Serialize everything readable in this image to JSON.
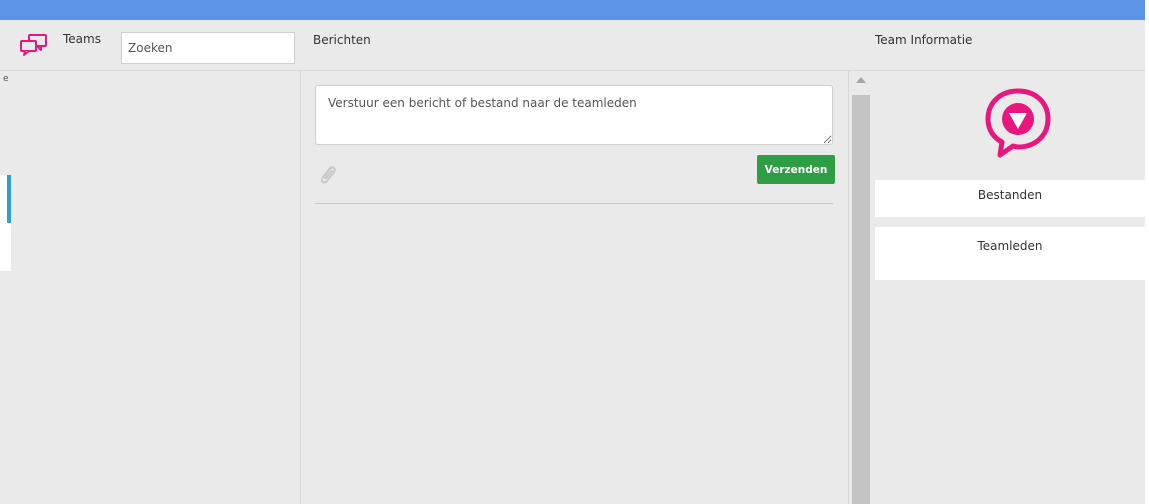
{
  "header": {
    "teams_label": "Teams",
    "search_placeholder": "Zoeken",
    "messages_title": "Berichten",
    "team_info_title": "Team Informatie"
  },
  "messages": {
    "input_placeholder": "Verstuur een bericht of bestand naar de teamleden",
    "send_label": "Verzenden"
  },
  "team_info": {
    "files_label": "Bestanden",
    "members_label": "Teamleden"
  },
  "left_panel": {
    "edge_char": "e"
  },
  "colors": {
    "topbar": "#5b93e6",
    "accent_pink": "#e8177e",
    "send_green": "#2e9e44",
    "selected_blue": "#2a9fd8"
  },
  "icons": {
    "teams": "chat-bubbles-icon",
    "attach": "paperclip-icon",
    "logo": "speech-bubble-v-logo"
  }
}
